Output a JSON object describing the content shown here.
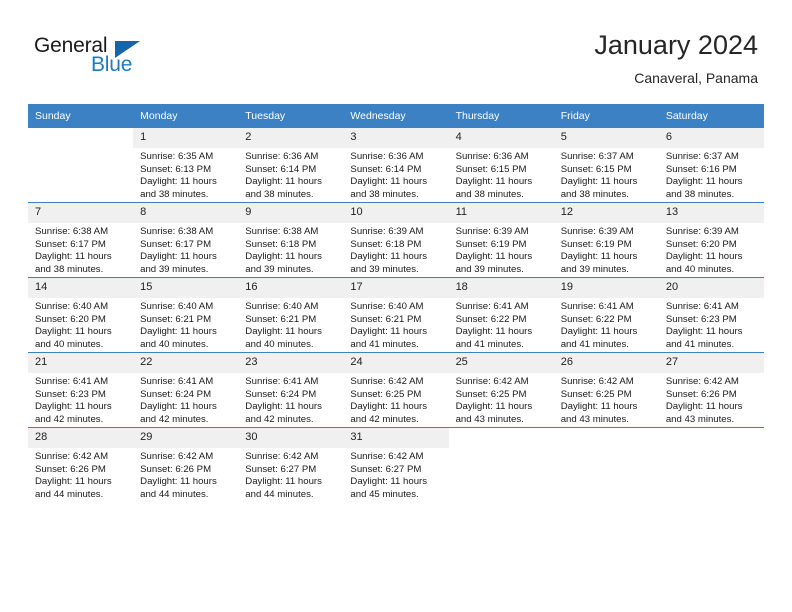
{
  "brand": {
    "name_part1": "General",
    "name_part2": "Blue",
    "triangle_icon": "triangle-icon",
    "color_dark": "#1b1b1b",
    "color_blue": "#1f7bc4"
  },
  "header": {
    "title": "January 2024",
    "location": "Canaveral, Panama"
  },
  "theme": {
    "header_bg": "#3b81c4",
    "daynum_bg": "#f0f0f0",
    "row_border": "#3b81c4",
    "text": "#1a1a1a"
  },
  "weekdays": [
    "Sunday",
    "Monday",
    "Tuesday",
    "Wednesday",
    "Thursday",
    "Friday",
    "Saturday"
  ],
  "weeks": [
    [
      {
        "day": "",
        "sunrise": "",
        "sunset": "",
        "daylight_line1": "",
        "daylight_line2": ""
      },
      {
        "day": "1",
        "sunrise": "Sunrise: 6:35 AM",
        "sunset": "Sunset: 6:13 PM",
        "daylight_line1": "Daylight: 11 hours",
        "daylight_line2": "and 38 minutes."
      },
      {
        "day": "2",
        "sunrise": "Sunrise: 6:36 AM",
        "sunset": "Sunset: 6:14 PM",
        "daylight_line1": "Daylight: 11 hours",
        "daylight_line2": "and 38 minutes."
      },
      {
        "day": "3",
        "sunrise": "Sunrise: 6:36 AM",
        "sunset": "Sunset: 6:14 PM",
        "daylight_line1": "Daylight: 11 hours",
        "daylight_line2": "and 38 minutes."
      },
      {
        "day": "4",
        "sunrise": "Sunrise: 6:36 AM",
        "sunset": "Sunset: 6:15 PM",
        "daylight_line1": "Daylight: 11 hours",
        "daylight_line2": "and 38 minutes."
      },
      {
        "day": "5",
        "sunrise": "Sunrise: 6:37 AM",
        "sunset": "Sunset: 6:15 PM",
        "daylight_line1": "Daylight: 11 hours",
        "daylight_line2": "and 38 minutes."
      },
      {
        "day": "6",
        "sunrise": "Sunrise: 6:37 AM",
        "sunset": "Sunset: 6:16 PM",
        "daylight_line1": "Daylight: 11 hours",
        "daylight_line2": "and 38 minutes."
      }
    ],
    [
      {
        "day": "7",
        "sunrise": "Sunrise: 6:38 AM",
        "sunset": "Sunset: 6:17 PM",
        "daylight_line1": "Daylight: 11 hours",
        "daylight_line2": "and 38 minutes."
      },
      {
        "day": "8",
        "sunrise": "Sunrise: 6:38 AM",
        "sunset": "Sunset: 6:17 PM",
        "daylight_line1": "Daylight: 11 hours",
        "daylight_line2": "and 39 minutes."
      },
      {
        "day": "9",
        "sunrise": "Sunrise: 6:38 AM",
        "sunset": "Sunset: 6:18 PM",
        "daylight_line1": "Daylight: 11 hours",
        "daylight_line2": "and 39 minutes."
      },
      {
        "day": "10",
        "sunrise": "Sunrise: 6:39 AM",
        "sunset": "Sunset: 6:18 PM",
        "daylight_line1": "Daylight: 11 hours",
        "daylight_line2": "and 39 minutes."
      },
      {
        "day": "11",
        "sunrise": "Sunrise: 6:39 AM",
        "sunset": "Sunset: 6:19 PM",
        "daylight_line1": "Daylight: 11 hours",
        "daylight_line2": "and 39 minutes."
      },
      {
        "day": "12",
        "sunrise": "Sunrise: 6:39 AM",
        "sunset": "Sunset: 6:19 PM",
        "daylight_line1": "Daylight: 11 hours",
        "daylight_line2": "and 39 minutes."
      },
      {
        "day": "13",
        "sunrise": "Sunrise: 6:39 AM",
        "sunset": "Sunset: 6:20 PM",
        "daylight_line1": "Daylight: 11 hours",
        "daylight_line2": "and 40 minutes."
      }
    ],
    [
      {
        "day": "14",
        "sunrise": "Sunrise: 6:40 AM",
        "sunset": "Sunset: 6:20 PM",
        "daylight_line1": "Daylight: 11 hours",
        "daylight_line2": "and 40 minutes."
      },
      {
        "day": "15",
        "sunrise": "Sunrise: 6:40 AM",
        "sunset": "Sunset: 6:21 PM",
        "daylight_line1": "Daylight: 11 hours",
        "daylight_line2": "and 40 minutes."
      },
      {
        "day": "16",
        "sunrise": "Sunrise: 6:40 AM",
        "sunset": "Sunset: 6:21 PM",
        "daylight_line1": "Daylight: 11 hours",
        "daylight_line2": "and 40 minutes."
      },
      {
        "day": "17",
        "sunrise": "Sunrise: 6:40 AM",
        "sunset": "Sunset: 6:21 PM",
        "daylight_line1": "Daylight: 11 hours",
        "daylight_line2": "and 41 minutes."
      },
      {
        "day": "18",
        "sunrise": "Sunrise: 6:41 AM",
        "sunset": "Sunset: 6:22 PM",
        "daylight_line1": "Daylight: 11 hours",
        "daylight_line2": "and 41 minutes."
      },
      {
        "day": "19",
        "sunrise": "Sunrise: 6:41 AM",
        "sunset": "Sunset: 6:22 PM",
        "daylight_line1": "Daylight: 11 hours",
        "daylight_line2": "and 41 minutes."
      },
      {
        "day": "20",
        "sunrise": "Sunrise: 6:41 AM",
        "sunset": "Sunset: 6:23 PM",
        "daylight_line1": "Daylight: 11 hours",
        "daylight_line2": "and 41 minutes."
      }
    ],
    [
      {
        "day": "21",
        "sunrise": "Sunrise: 6:41 AM",
        "sunset": "Sunset: 6:23 PM",
        "daylight_line1": "Daylight: 11 hours",
        "daylight_line2": "and 42 minutes."
      },
      {
        "day": "22",
        "sunrise": "Sunrise: 6:41 AM",
        "sunset": "Sunset: 6:24 PM",
        "daylight_line1": "Daylight: 11 hours",
        "daylight_line2": "and 42 minutes."
      },
      {
        "day": "23",
        "sunrise": "Sunrise: 6:41 AM",
        "sunset": "Sunset: 6:24 PM",
        "daylight_line1": "Daylight: 11 hours",
        "daylight_line2": "and 42 minutes."
      },
      {
        "day": "24",
        "sunrise": "Sunrise: 6:42 AM",
        "sunset": "Sunset: 6:25 PM",
        "daylight_line1": "Daylight: 11 hours",
        "daylight_line2": "and 42 minutes."
      },
      {
        "day": "25",
        "sunrise": "Sunrise: 6:42 AM",
        "sunset": "Sunset: 6:25 PM",
        "daylight_line1": "Daylight: 11 hours",
        "daylight_line2": "and 43 minutes."
      },
      {
        "day": "26",
        "sunrise": "Sunrise: 6:42 AM",
        "sunset": "Sunset: 6:25 PM",
        "daylight_line1": "Daylight: 11 hours",
        "daylight_line2": "and 43 minutes."
      },
      {
        "day": "27",
        "sunrise": "Sunrise: 6:42 AM",
        "sunset": "Sunset: 6:26 PM",
        "daylight_line1": "Daylight: 11 hours",
        "daylight_line2": "and 43 minutes."
      }
    ],
    [
      {
        "day": "28",
        "sunrise": "Sunrise: 6:42 AM",
        "sunset": "Sunset: 6:26 PM",
        "daylight_line1": "Daylight: 11 hours",
        "daylight_line2": "and 44 minutes."
      },
      {
        "day": "29",
        "sunrise": "Sunrise: 6:42 AM",
        "sunset": "Sunset: 6:26 PM",
        "daylight_line1": "Daylight: 11 hours",
        "daylight_line2": "and 44 minutes."
      },
      {
        "day": "30",
        "sunrise": "Sunrise: 6:42 AM",
        "sunset": "Sunset: 6:27 PM",
        "daylight_line1": "Daylight: 11 hours",
        "daylight_line2": "and 44 minutes."
      },
      {
        "day": "31",
        "sunrise": "Sunrise: 6:42 AM",
        "sunset": "Sunset: 6:27 PM",
        "daylight_line1": "Daylight: 11 hours",
        "daylight_line2": "and 45 minutes."
      },
      {
        "day": "",
        "sunrise": "",
        "sunset": "",
        "daylight_line1": "",
        "daylight_line2": ""
      },
      {
        "day": "",
        "sunrise": "",
        "sunset": "",
        "daylight_line1": "",
        "daylight_line2": ""
      },
      {
        "day": "",
        "sunrise": "",
        "sunset": "",
        "daylight_line1": "",
        "daylight_line2": ""
      }
    ]
  ]
}
